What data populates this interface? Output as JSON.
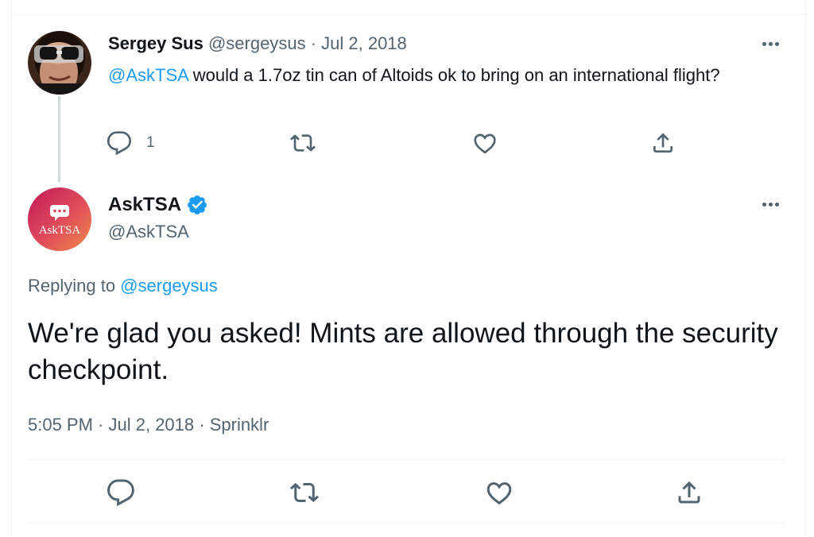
{
  "tweet1": {
    "name": "Sergey Sus",
    "handle": "@sergeysus",
    "separator": " · ",
    "date": "Jul 2, 2018",
    "mention": "@AskTSA",
    "text": " would a 1.7oz tin can of Altoids ok to bring on an international flight?",
    "reply_count": "1",
    "icons": [
      "reply-icon",
      "retweet-icon",
      "like-icon",
      "share-icon",
      "more-icon"
    ]
  },
  "reply": {
    "name": "AskTSA",
    "handle": "@AskTSA",
    "avatar_label": "AskTSA",
    "verified": true,
    "replying_prefix": "Replying to ",
    "replying_to": "@sergeysus",
    "text": "We're glad you asked! Mints are allowed through the security checkpoint.",
    "time": "5:05 PM",
    "date": "Jul 2, 2018",
    "source": "Sprinklr",
    "separator": " · "
  },
  "colors": {
    "accent": "#1d9bf0",
    "text": "#0f1419",
    "muted": "#536471"
  }
}
